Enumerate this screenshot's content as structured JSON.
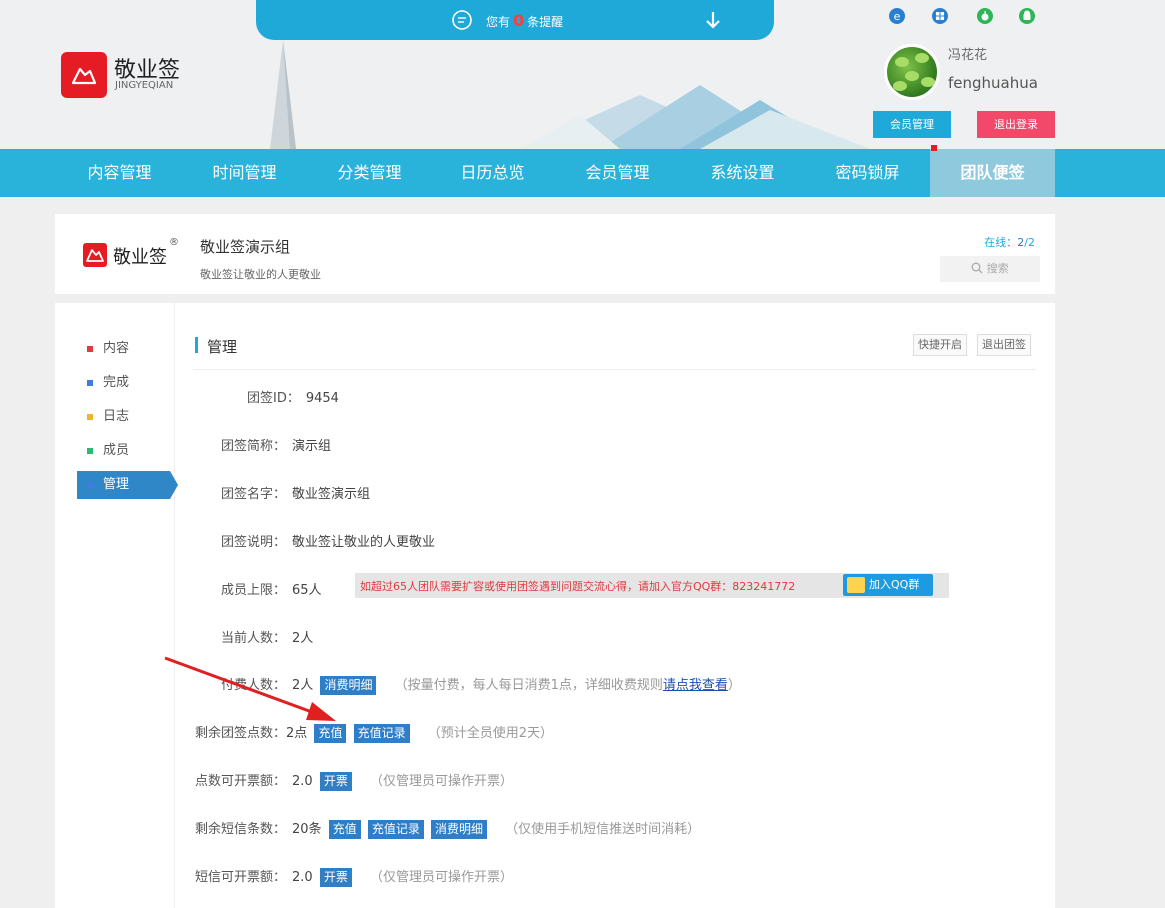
{
  "notice": {
    "prefix": "您有",
    "count": "0",
    "suffix": "条提醒"
  },
  "logo": {
    "name_cn": "敬业签",
    "name_en": "JINGYEQIAN"
  },
  "user": {
    "name_cn": "冯花花",
    "name_en": "fenghuahua",
    "member_button": "会员管理",
    "logout_button": "退出登录"
  },
  "platforms": [
    "ie-icon",
    "windows-icon",
    "apple-icon",
    "android-icon"
  ],
  "nav": [
    {
      "label": "内容管理"
    },
    {
      "label": "时间管理"
    },
    {
      "label": "分类管理"
    },
    {
      "label": "日历总览"
    },
    {
      "label": "会员管理"
    },
    {
      "label": "系统设置"
    },
    {
      "label": "密码锁屏"
    },
    {
      "label": "团队便签",
      "active": true
    }
  ],
  "group": {
    "brand": "敬业签",
    "reg": "®",
    "name": "敬业签演示组",
    "desc": "敬业签让敬业的人更敬业",
    "online_label": "在线：",
    "online_value": "2",
    "online_total": "/2",
    "search_placeholder": "搜索"
  },
  "sidebar": [
    {
      "label": "内容",
      "color": "#e5393e"
    },
    {
      "label": "完成",
      "color": "#3d7ee0"
    },
    {
      "label": "日志",
      "color": "#f2b32a"
    },
    {
      "label": "成员",
      "color": "#2eb872"
    },
    {
      "label": "管理",
      "color": "#3d7ee0",
      "active": true
    }
  ],
  "section": {
    "title": "管理",
    "quick_open": "快捷开启",
    "quit": "退出团签"
  },
  "rows": {
    "id_label": "团签ID：",
    "id_value": "9454",
    "short_label": "团签简称：",
    "short_value": "演示组",
    "name_label": "团签名字：",
    "name_value": "敬业签演示组",
    "desc_label": "团签说明：",
    "desc_value": "敬业签让敬业的人更敬业",
    "limit_label": "成员上限：",
    "limit_value": "65人",
    "limit_warn": "如超过65人团队需要扩容或使用团签遇到问题交流心得，请加入官方QQ群：823241772",
    "qq_button": "加入QQ群",
    "current_label": "当前人数：",
    "current_value": "2人",
    "paid_label": "付费人数：",
    "paid_value": "2人",
    "paid_detail": "消费明细",
    "paid_note_prefix": "（按量付费，每人每日消费1点，详细收费规则",
    "paid_note_link": "请点我查看",
    "paid_note_suffix": "）",
    "points_label": "剩余团签点数：",
    "points_value": "2点",
    "recharge": "充值",
    "recharge_record": "充值记录",
    "points_note": "（预计全员使用2天）",
    "invoice_label": "点数可开票额：",
    "invoice_value": "2.0",
    "invoice_btn": "开票",
    "invoice_note": "（仅管理员可操作开票）",
    "sms_label": "剩余短信条数：",
    "sms_value": "20条",
    "sms_recharge": "充值",
    "sms_record": "充值记录",
    "sms_detail": "消费明细",
    "sms_note": "（仅使用手机短信推送时间消耗）",
    "sms_invoice_label": "短信可开票额：",
    "sms_invoice_value": "2.0",
    "sms_invoice_btn": "开票",
    "sms_invoice_note": "（仅管理员可操作开票）"
  }
}
